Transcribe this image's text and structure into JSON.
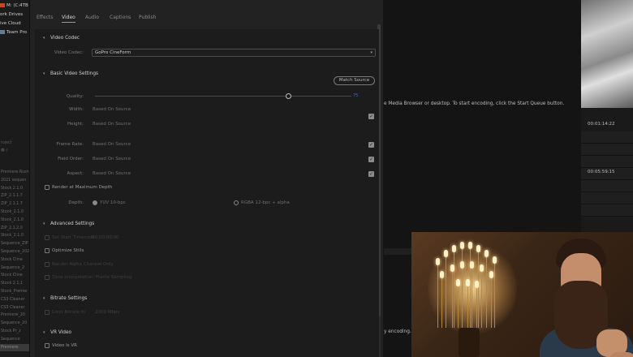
{
  "sidebar": {
    "top_items": [
      {
        "label": "M: (C:4TB",
        "icon": "drive-icon"
      },
      {
        "label": "ork Drives",
        "icon": ""
      },
      {
        "label": "ive Cloud",
        "icon": ""
      },
      {
        "label": "Team Pro",
        "icon": "team-icon"
      }
    ],
    "mid_rows": [
      "roject",
      "",
      "",
      ""
    ],
    "list_rows": [
      "Premiere Rush",
      "2021 sequen",
      "Stock 2.1.0",
      "ZIP_2.1.1.7",
      "ZIP_2.1.1.7",
      "Stock_2.1.0",
      "Stock_2.1.0",
      "ZIP_2.1.2.0",
      "Stock_2.1.0",
      "Sequence_ZIP",
      "Sequence_2021",
      "Stock Cline",
      "Sequence_2",
      "Stock Cline",
      "Stock 2.1.1",
      "Stock_Premie",
      "CS3 Cleaner",
      "CS3 Cleaner",
      "Premiere_20",
      "Sequence_20",
      "Stock Pr_z",
      "Sequence",
      "Premiere"
    ]
  },
  "panel": {
    "tabs": [
      "Effects",
      "Video",
      "Audio",
      "Captions",
      "Publish"
    ],
    "active_tab": "Video",
    "video_codec": {
      "section": "Video Codec",
      "label": "Video Codec:",
      "value": "GoPro CineForm"
    },
    "basic_video": {
      "section": "Basic Video Settings",
      "match_source": "Match Source",
      "quality_label": "Quality:",
      "quality_value": "75",
      "width_label": "Width:",
      "width_value": "Based On Source",
      "height_label": "Height:",
      "height_value": "Based On Source",
      "frame_rate_label": "Frame Rate:",
      "frame_rate_value": "Based On Source",
      "field_order_label": "Field Order:",
      "field_order_value": "Based On Source",
      "aspect_label": "Aspect:",
      "aspect_value": "Based On Source",
      "render_max_depth": "Render at Maximum Depth",
      "depth_label": "Depth:",
      "depth_yuv": "YUV 10-bpc",
      "depth_rgba": "RGBA 12-bpc + alpha"
    },
    "advanced": {
      "section": "Advanced Settings",
      "set_start_tc": "Set Start Timecode",
      "start_tc_value": "00;00;00;00",
      "optimize_stills": "Optimize Stills",
      "render_alpha": "Render Alpha Channel Only",
      "time_interp": "Time Interpolation: Frame Sampling"
    },
    "bitrate": {
      "section": "Bitrate Settings",
      "limit_bitrate": "Limit Bitrate to",
      "limit_value": "2000 Mbps"
    },
    "vr": {
      "section": "VR Video",
      "video_is_vr": "Video Is VR"
    }
  },
  "queue": {
    "message": "e Media Browser or desktop.  To start encoding, click the Start Queue button.",
    "message2": "y encoding."
  },
  "preview": {
    "timecode_1": "00:01:14:22",
    "timecode_2": "00:05:59:15"
  },
  "colors": {
    "panel_bg": "#222222",
    "content_bg": "#1c1c1c",
    "accent_blue": "#3a6fbf"
  }
}
